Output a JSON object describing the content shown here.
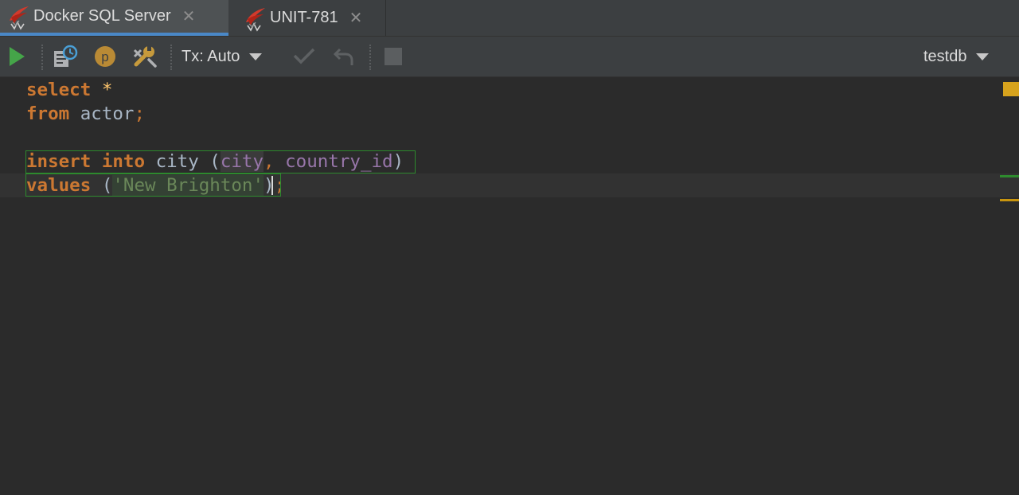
{
  "tabs": [
    {
      "label": "Docker SQL Server",
      "active": true,
      "close": "✕"
    },
    {
      "label": "UNIT-781",
      "active": false,
      "close": "✕"
    }
  ],
  "toolbar": {
    "tx_label": "Tx: Auto",
    "database": "testdb",
    "icons": [
      "run-icon",
      "query-history-icon",
      "parameters-icon",
      "settings-wrench-icon",
      "commit-check-icon",
      "rollback-undo-icon",
      "stop-icon"
    ]
  },
  "editor": {
    "lines": [
      {
        "tokens": [
          "select",
          "*"
        ]
      },
      {
        "tokens": [
          "from",
          "actor",
          ";"
        ]
      },
      {
        "tokens": []
      },
      {
        "tokens": [
          "insert",
          "into",
          "city",
          "(",
          "city",
          ",",
          "country_id",
          ")"
        ]
      },
      {
        "tokens": [
          "values",
          "(",
          "'New Brighton'",
          ")",
          ";"
        ]
      }
    ]
  },
  "colors": {
    "keyword": "#cc7832",
    "identifier": "#a9b7c6",
    "column": "#9876aa",
    "string": "#6a8759",
    "accent_tab": "#4a88c7",
    "statement_outline": "#2d8a2d"
  }
}
